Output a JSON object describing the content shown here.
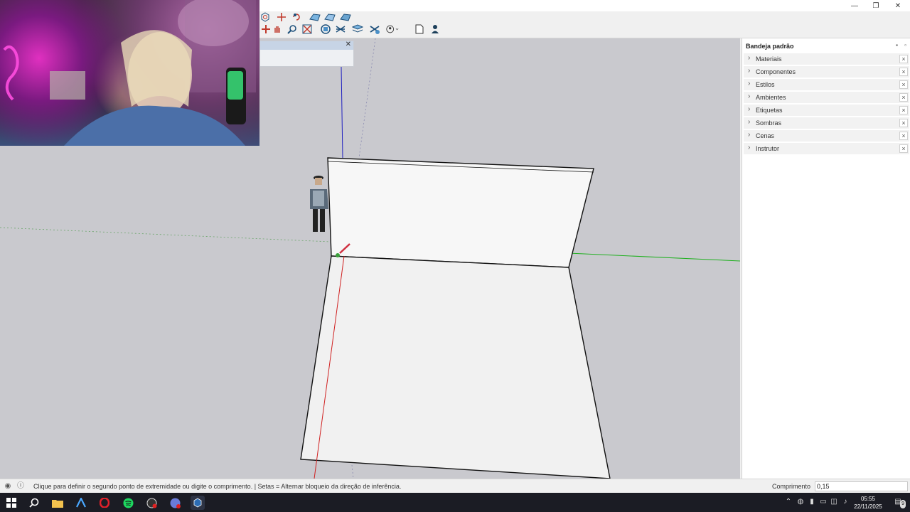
{
  "window": {
    "minimize_glyph": "—",
    "restore_glyph": "❐",
    "close_glyph": "✕"
  },
  "toolbar": {
    "icons": [
      "move-icon",
      "pan-hand-icon",
      "zoom-icon",
      "zoom-window-icon",
      "zoom-extents-icon",
      "xray-icon",
      "layers-icon",
      "section-icon",
      "account-icon",
      "new-file-icon",
      "person-icon"
    ]
  },
  "floating_toolbar": {
    "close_glyph": "✕",
    "icons": [
      "circle-icon",
      "move-arrows-icon",
      "rotate-icon",
      "surface-icon-1",
      "surface-icon-2",
      "surface-icon-3"
    ]
  },
  "tray": {
    "title": "Bandeja padrão",
    "panels": [
      {
        "label": "Materiais"
      },
      {
        "label": "Componentes"
      },
      {
        "label": "Estilos"
      },
      {
        "label": "Ambientes"
      },
      {
        "label": "Etiquetas"
      },
      {
        "label": "Sombras"
      },
      {
        "label": "Cenas"
      },
      {
        "label": "Instrutor"
      }
    ],
    "chevron": "›",
    "close_glyph": "×"
  },
  "statusbar": {
    "hint": "Clique para definir o segundo ponto de extremidade ou digite o comprimento. | Setas = Alternar bloqueio da direção de inferência.",
    "measurement_label": "Comprimento",
    "measurement_value": "0,15"
  },
  "taskbar": {
    "time": "05:55",
    "date": "22/11/2025",
    "notification_count": "9"
  },
  "colors": {
    "viewport_bg": "#c9c9ce",
    "axis_red": "#d02020",
    "axis_green": "#20b020",
    "axis_blue": "#2020c0",
    "face": "#f6f6f6"
  }
}
